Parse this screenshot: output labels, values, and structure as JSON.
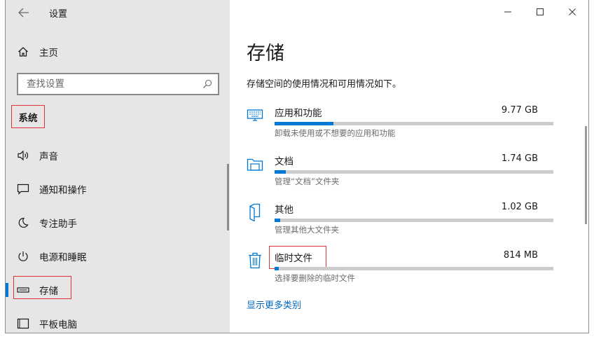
{
  "window": {
    "title": "设置"
  },
  "sidebar": {
    "home_label": "主页",
    "search_placeholder": "查找设置",
    "section_title": "系统",
    "items": [
      {
        "label": "声音",
        "icon": "speaker-icon"
      },
      {
        "label": "通知和操作",
        "icon": "notification-icon"
      },
      {
        "label": "专注助手",
        "icon": "moon-icon"
      },
      {
        "label": "电源和睡眠",
        "icon": "power-icon"
      },
      {
        "label": "存储",
        "icon": "storage-icon",
        "selected": true
      },
      {
        "label": "平板电脑",
        "icon": "tablet-icon"
      }
    ]
  },
  "main": {
    "title": "存储",
    "description": "存储空间的使用情况和可用情况如下。",
    "categories": [
      {
        "name": "应用和功能",
        "size": "9.77 GB",
        "subtitle": "卸载未使用或不想要的应用和功能",
        "usage_fraction": 0.21,
        "icon": "apps-icon"
      },
      {
        "name": "文档",
        "size": "1.74 GB",
        "subtitle": "管理“文档”文件夹",
        "usage_fraction": 0.04,
        "icon": "documents-folder-icon"
      },
      {
        "name": "其他",
        "size": "1.02 GB",
        "subtitle": "管理其他大文件夹",
        "usage_fraction": 0.02,
        "icon": "other-files-icon"
      },
      {
        "name": "临时文件",
        "size": "814 MB",
        "subtitle": "选择要删除的临时文件",
        "usage_fraction": 0.015,
        "icon": "trash-icon"
      }
    ],
    "more_link": "显示更多类别"
  },
  "colors": {
    "accent": "#0078d4",
    "highlight_box": "#e0303a",
    "sidebar_bg": "#e6e6e6",
    "link": "#0067c0"
  }
}
